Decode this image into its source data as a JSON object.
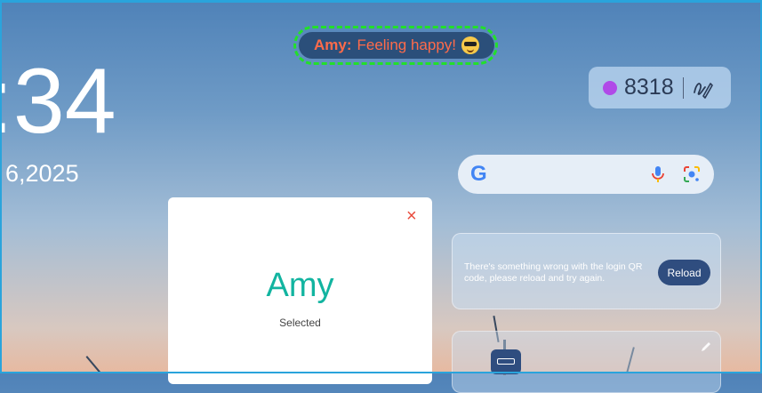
{
  "status": {
    "name": "Amy:",
    "message": "Feeling happy!",
    "emoji": "sunglasses-emoji"
  },
  "clock": {
    "time": ":34",
    "date": "6,2025"
  },
  "counter": {
    "value": "8318",
    "dot_color": "#b04ae8"
  },
  "search": {
    "logo": "G"
  },
  "user_card": {
    "name": "Amy",
    "subtitle": "Selected",
    "close_label": "×"
  },
  "qr_notice": {
    "message": "There's something wrong with the login QR code, please reload and try again.",
    "reload_label": "Reload"
  },
  "colors": {
    "accent": "#12b4a0",
    "button": "#2f4d7f",
    "status_text": "#ff6b4a",
    "highlight": "#22e02a"
  }
}
